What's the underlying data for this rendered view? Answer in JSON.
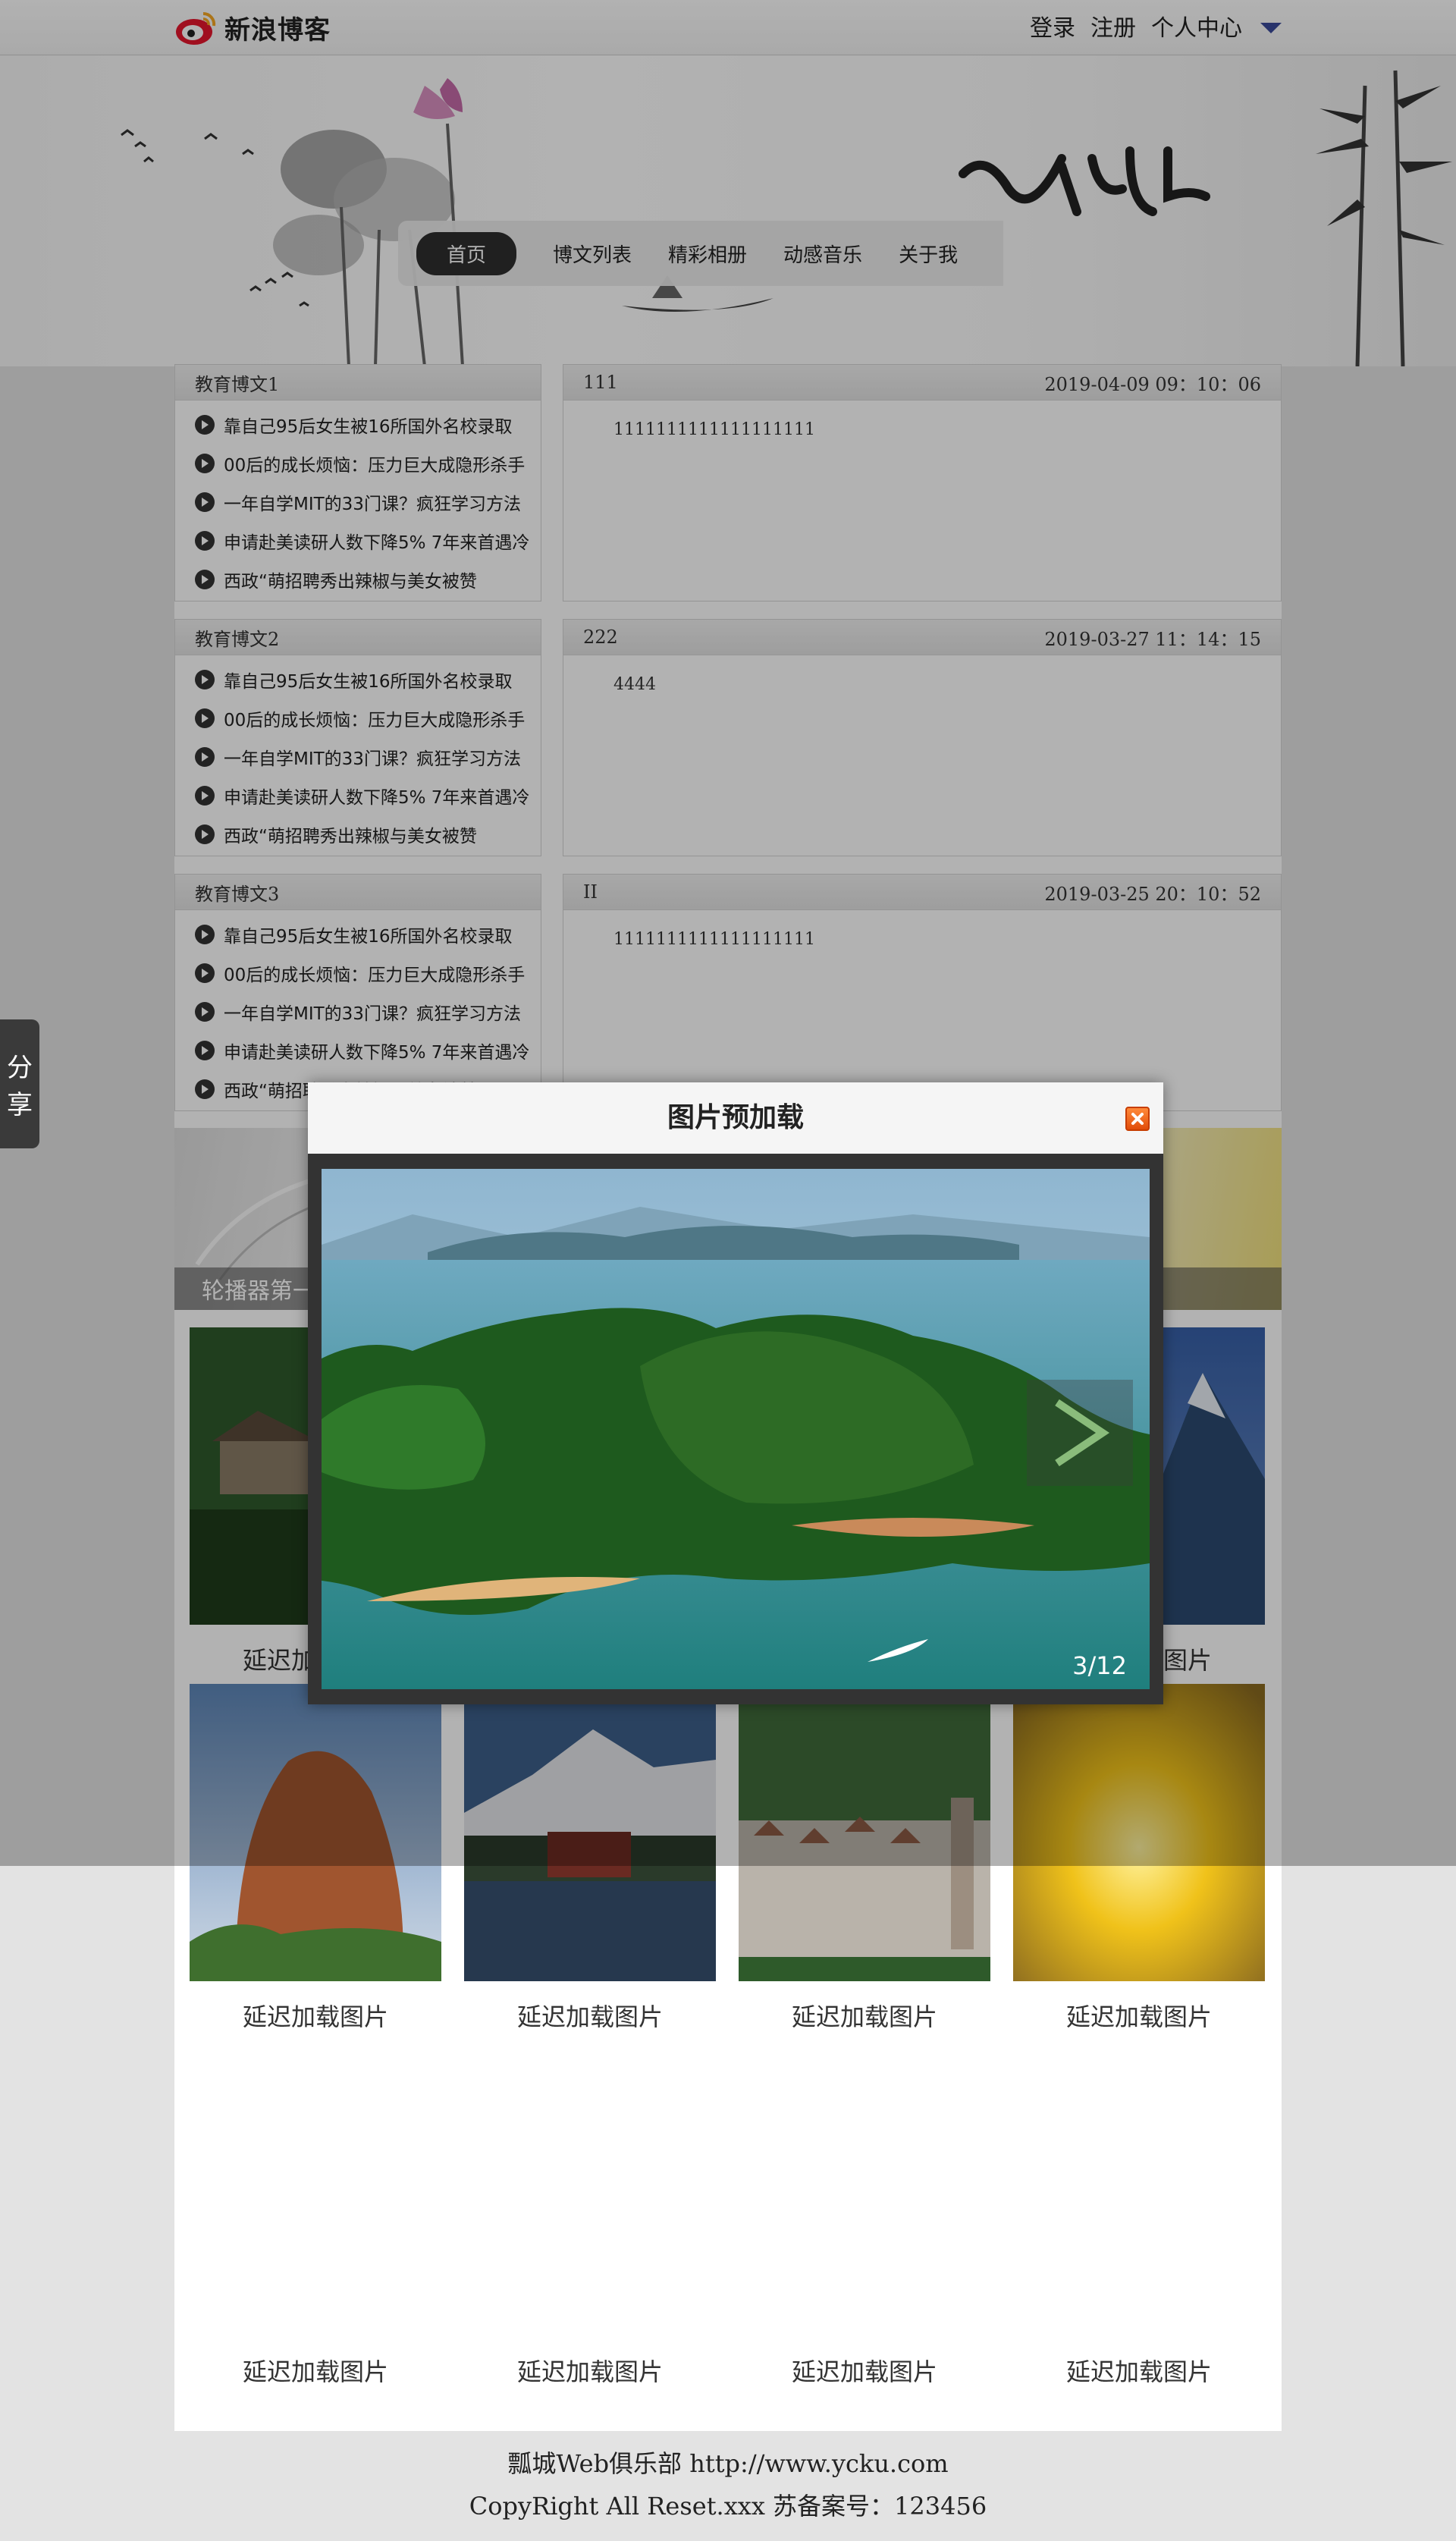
{
  "brand": {
    "logo_text": "新浪博客"
  },
  "topnav": {
    "login": "登录",
    "register": "注册",
    "user_center": "个人中心"
  },
  "mainnav": [
    "首页",
    "博文列表",
    "精彩相册",
    "动感音乐",
    "关于我"
  ],
  "blocks": [
    {
      "left_title": "教育博文1",
      "news": [
        "靠自己95后女生被16所国外名校录取",
        "00后的成长烦恼：压力巨大成隐形杀手",
        "一年自学MIT的33门课？疯狂学习方法",
        "申请赴美读研人数下降5% 7年来首遇冷",
        "西政“萌招聘秀出辣椒与美女被赞"
      ],
      "post_title": "111",
      "post_date": "2019-04-09 09：10：06",
      "post_body": "1111111111111111111"
    },
    {
      "left_title": "教育博文2",
      "news": [
        "靠自己95后女生被16所国外名校录取",
        "00后的成长烦恼：压力巨大成隐形杀手",
        "一年自学MIT的33门课？疯狂学习方法",
        "申请赴美读研人数下降5% 7年来首遇冷",
        "西政“萌招聘秀出辣椒与美女被赞"
      ],
      "post_title": "222",
      "post_date": "2019-03-27 11：14：15",
      "post_body": "4444"
    },
    {
      "left_title": "教育博文3",
      "news": [
        "靠自己95后女生被16所国外名校录取",
        "00后的成长烦恼：压力巨大成隐形杀手",
        "一年自学MIT的33门课？疯狂学习方法",
        "申请赴美读研人数下降5% 7年来首遇冷",
        "西政“萌招聘秀出辣椒与美女被赞"
      ],
      "post_title": "II",
      "post_date": "2019-03-25 20：10：52",
      "post_body": "1111111111111111111"
    }
  ],
  "carousel": {
    "caption": "轮播器第一"
  },
  "gallery": {
    "caption": "延迟加载图片"
  },
  "footer": {
    "line1": "瓢城Web俱乐部 http://www.ycku.com",
    "line2": "CopyRight All Reset.xxx 苏备案号：123456"
  },
  "share": {
    "label_1": "分",
    "label_2": "享"
  },
  "modal": {
    "title": "图片预加载",
    "counter": "3/12"
  },
  "colors": {
    "overlay": "#000000",
    "nav_active": "#2e2e2e",
    "close_button": "#e8601c",
    "arrow": "#3a4a9a"
  },
  "icons": [
    "weibo-logo-icon",
    "chevron-down-icon",
    "circle-arrow-icon",
    "close-icon",
    "next-arrow-icon"
  ]
}
